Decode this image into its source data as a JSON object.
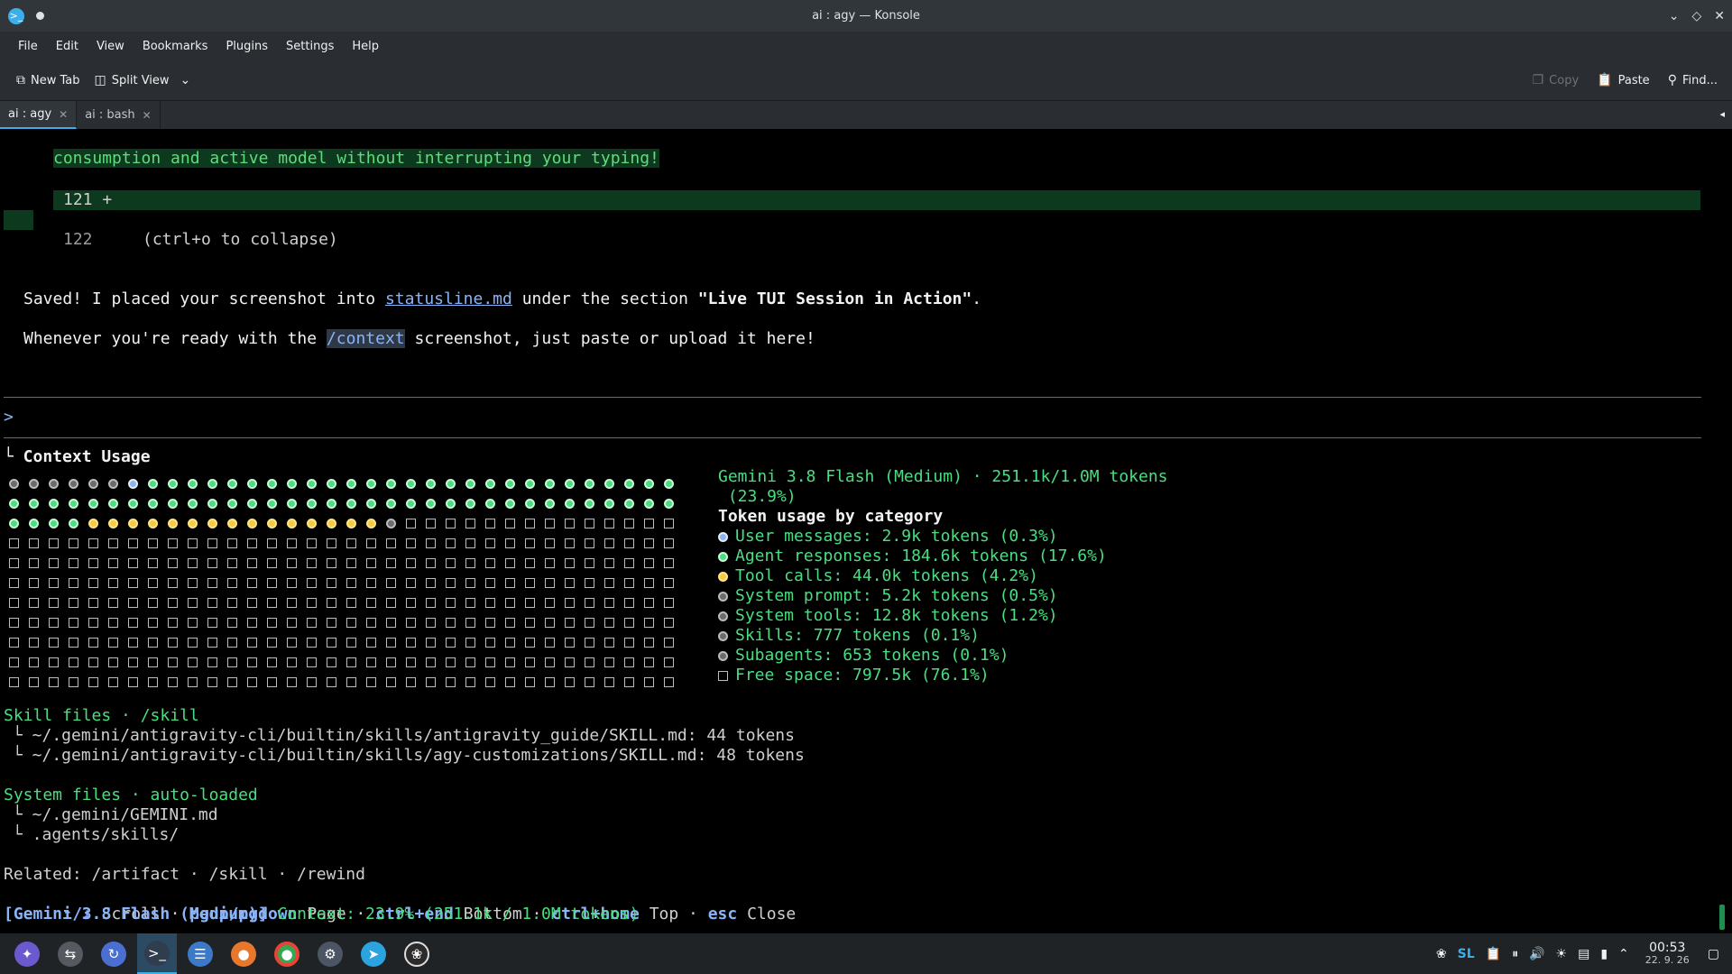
{
  "window": {
    "title": "ai : agy — Konsole"
  },
  "menu": [
    "File",
    "Edit",
    "View",
    "Bookmarks",
    "Plugins",
    "Settings",
    "Help"
  ],
  "toolbar": {
    "new_tab": "New Tab",
    "split_view": "Split View",
    "copy": "Copy",
    "paste": "Paste",
    "find": "Find..."
  },
  "tabs": [
    {
      "label": "ai : agy"
    },
    {
      "label": "ai : bash"
    }
  ],
  "terminal": {
    "diff_line": "consumption and active model without interrupting your typing!",
    "ln121": "121 +",
    "ln122": "122",
    "ln122_text": "(ctrl+o to collapse)",
    "saved_pre": "Saved! I placed your screenshot into ",
    "saved_link": "statusline.md",
    "saved_mid": " under the section ",
    "saved_bold": "\"Live TUI Session in Action\"",
    "saved_end": ".",
    "ready_pre": "Whenever you're ready with the ",
    "ready_cmd": "/context",
    "ready_post": " screenshot, just paste or upload it here!",
    "prompt": ">",
    "context_header": "└ Context Usage",
    "model_line": "Gemini 3.8 Flash (Medium) · 251.1k/1.0M tokens",
    "model_pct": " (23.9%)",
    "category_title": "Token usage by category",
    "categories": [
      {
        "label": "User messages: 2.9k tokens (0.3%)",
        "kind": "user"
      },
      {
        "label": "Agent responses: 184.6k tokens (17.6%)",
        "kind": "agent"
      },
      {
        "label": "Tool calls: 44.0k tokens (4.2%)",
        "kind": "tool"
      },
      {
        "label": "System prompt: 5.2k tokens (0.5%)",
        "kind": "sys"
      },
      {
        "label": "System tools: 12.8k tokens (1.2%)",
        "kind": "sys"
      },
      {
        "label": "Skills: 777 tokens (0.1%)",
        "kind": "sys"
      },
      {
        "label": "Subagents: 653 tokens (0.1%)",
        "kind": "sys"
      },
      {
        "label": "Free space: 797.5k (76.1%)",
        "kind": "free"
      }
    ],
    "skill_header": "Skill files · /skill",
    "skill_files": [
      "└ ~/.gemini/antigravity-cli/builtin/skills/antigravity_guide/SKILL.md: 44 tokens",
      "└ ~/.gemini/antigravity-cli/builtin/skills/agy-customizations/SKILL.md: 48 tokens"
    ],
    "system_header": "System files · auto-loaded",
    "system_files": [
      "└ ~/.gemini/GEMINI.md",
      "└ .agents/skills/"
    ],
    "related": "Related: /artifact · /skill · /rewind",
    "keys": [
      {
        "key": "↑/↓",
        "desc": "Scroll"
      },
      {
        "key": "pgup/pgdown",
        "desc": "Page"
      },
      {
        "key": "ctrl+end",
        "desc": "Bottom"
      },
      {
        "key": "ctrl+home",
        "desc": "Top"
      },
      {
        "key": "esc",
        "desc": "Close"
      }
    ],
    "status_model": "[Gemini 3.8 Flash (Medium)]",
    "status_ctx": " Context: 23.9% (251.1k / 1.0M tokens)"
  },
  "grid": {
    "columns": 34,
    "rows": [
      [
        "sys",
        "sys",
        "sys",
        "sys",
        "sys",
        "sys",
        "user",
        "agent",
        "agent",
        "agent",
        "agent",
        "agent",
        "agent",
        "agent",
        "agent",
        "agent",
        "agent",
        "agent",
        "agent",
        "agent",
        "agent",
        "agent",
        "agent",
        "agent",
        "agent",
        "agent",
        "agent",
        "agent",
        "agent",
        "agent",
        "agent",
        "agent",
        "agent",
        "agent"
      ],
      [
        "agent",
        "agent",
        "agent",
        "agent",
        "agent",
        "agent",
        "agent",
        "agent",
        "agent",
        "agent",
        "agent",
        "agent",
        "agent",
        "agent",
        "agent",
        "agent",
        "agent",
        "agent",
        "agent",
        "agent",
        "agent",
        "agent",
        "agent",
        "agent",
        "agent",
        "agent",
        "agent",
        "agent",
        "agent",
        "agent",
        "agent",
        "agent",
        "agent",
        "agent"
      ],
      [
        "agent",
        "agent",
        "agent",
        "agent",
        "tool",
        "tool",
        "tool",
        "tool",
        "tool",
        "tool",
        "tool",
        "tool",
        "tool",
        "tool",
        "tool",
        "tool",
        "tool",
        "tool",
        "tool",
        "sys",
        "free",
        "free",
        "free",
        "free",
        "free",
        "free",
        "free",
        "free",
        "free",
        "free",
        "free",
        "free",
        "free",
        "free"
      ]
    ],
    "free_rows": 8
  },
  "taskbar": {
    "clock_time": "00:53",
    "clock_date": "22. 9. 26",
    "tray_text": "SL"
  }
}
